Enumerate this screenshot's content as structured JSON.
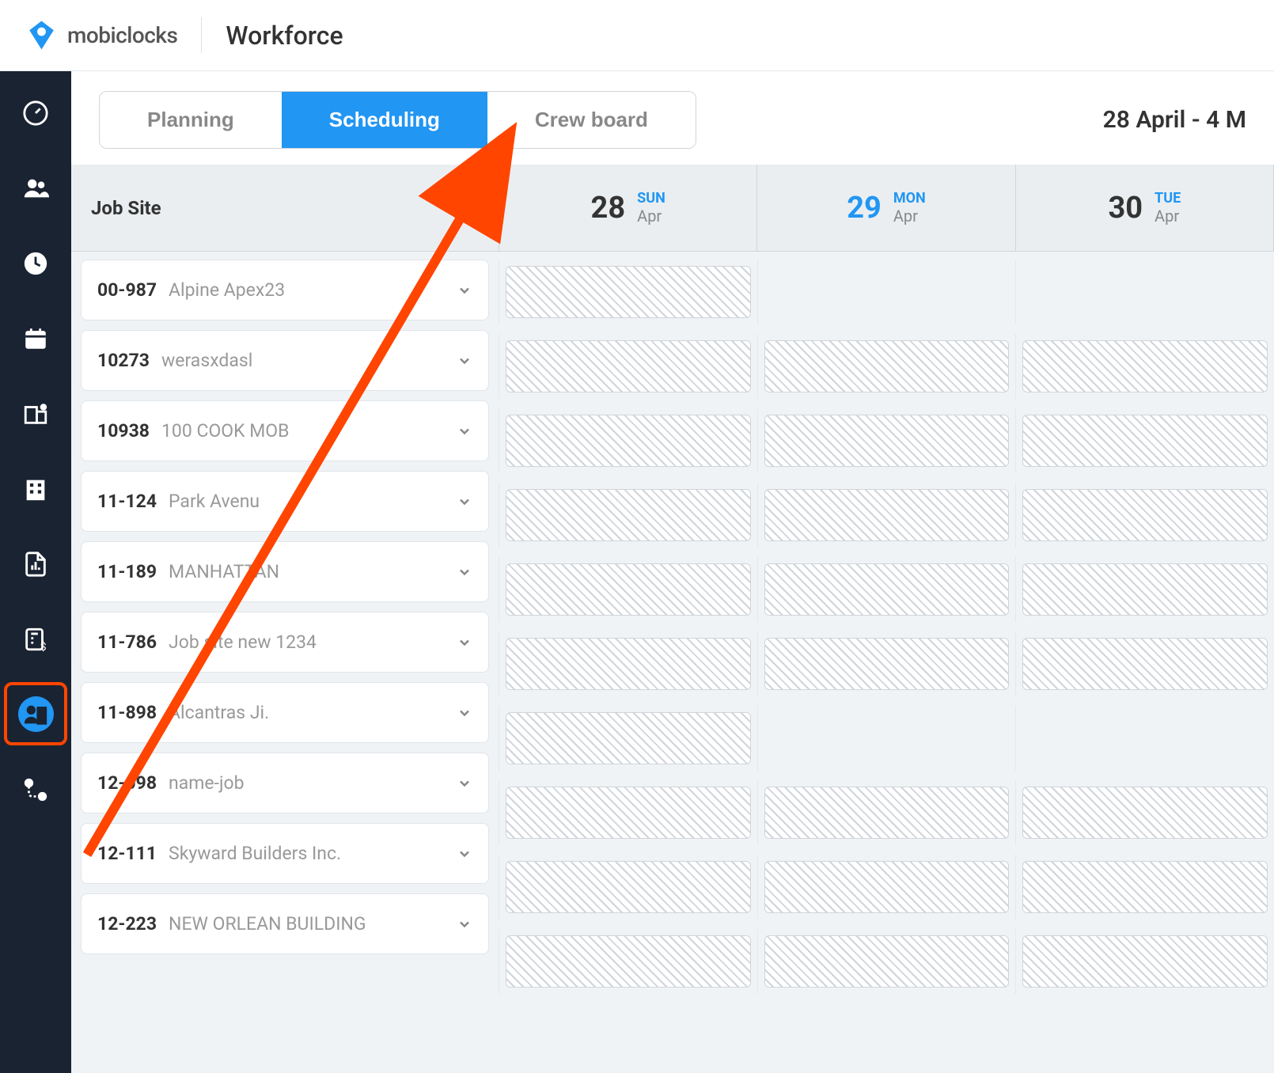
{
  "header": {
    "brand": "mobiclocks",
    "page_title": "Workforce"
  },
  "tabs": {
    "items": [
      {
        "label": "Planning",
        "active": false
      },
      {
        "label": "Scheduling",
        "active": true
      },
      {
        "label": "Crew board",
        "active": false
      }
    ]
  },
  "date_range": "28 April - 4 M",
  "column_header": "Job Site",
  "days": [
    {
      "num": "28",
      "dow": "SUN",
      "month": "Apr",
      "active": false
    },
    {
      "num": "29",
      "dow": "MON",
      "month": "Apr",
      "active": true
    },
    {
      "num": "30",
      "dow": "TUE",
      "month": "Apr",
      "active": false
    }
  ],
  "jobsites": [
    {
      "code": "00-987",
      "name": "Alpine Apex23",
      "hatched_days": [
        0
      ]
    },
    {
      "code": "10273",
      "name": "werasxdasl",
      "hatched_days": [
        0,
        1,
        2
      ]
    },
    {
      "code": "10938",
      "name": "100 COOK MOB",
      "hatched_days": [
        0,
        1,
        2
      ]
    },
    {
      "code": "11-124",
      "name": "Park Avenu",
      "hatched_days": [
        0,
        1,
        2
      ]
    },
    {
      "code": "11-189",
      "name": "MANHATTAN",
      "hatched_days": [
        0,
        1,
        2
      ]
    },
    {
      "code": "11-786",
      "name": "Job site new 1234",
      "hatched_days": [
        0,
        1,
        2
      ]
    },
    {
      "code": "11-898",
      "name": "Alcantras Ji.",
      "hatched_days": [
        0
      ]
    },
    {
      "code": "12-098",
      "name": "name-job",
      "hatched_days": [
        0,
        1,
        2
      ]
    },
    {
      "code": "12-111",
      "name": "Skyward Builders Inc.",
      "hatched_days": [
        0,
        1,
        2
      ]
    },
    {
      "code": "12-223",
      "name": "NEW ORLEAN BUILDING",
      "hatched_days": [
        0,
        1,
        2
      ]
    }
  ],
  "sidebar_icons": [
    "gauge-icon",
    "users-icon",
    "clock-icon",
    "calendar-icon",
    "buildings-map-icon",
    "building-icon",
    "report-icon",
    "calculator-dollar-icon",
    "workforce-icon",
    "route-icon"
  ],
  "colors": {
    "accent": "#2196f3",
    "sidebar_bg": "#1a2332",
    "annotation": "#ff4500"
  }
}
